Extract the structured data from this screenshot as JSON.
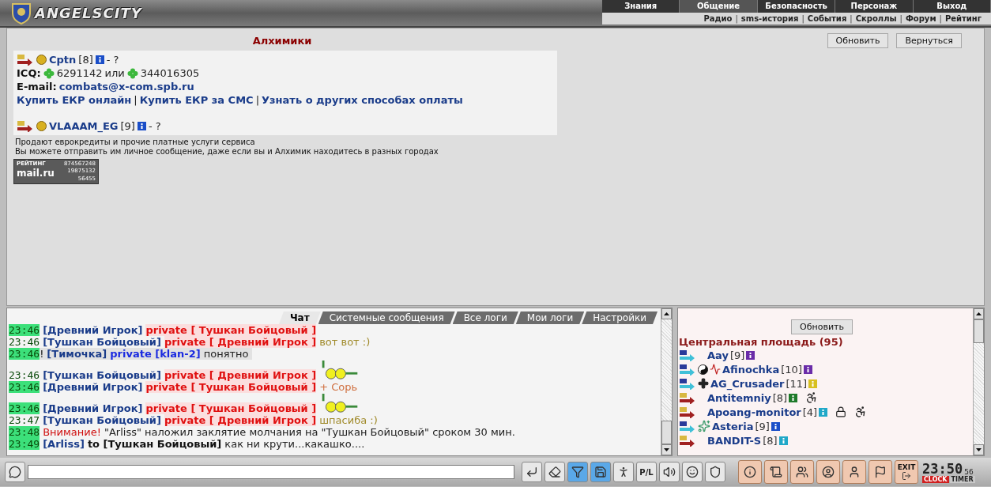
{
  "header": {
    "logo": "ANGELSCITY",
    "menu": [
      {
        "label": "Знания",
        "selected": false
      },
      {
        "label": "Общение",
        "selected": true
      },
      {
        "label": "Безопасность",
        "selected": false
      },
      {
        "label": "Персонаж",
        "selected": false
      },
      {
        "label": "Выход",
        "selected": false
      }
    ],
    "separator": "|",
    "submenu": [
      "Радио",
      "sms-история",
      "События",
      "Скроллы",
      "Форум",
      "Рейтинг"
    ]
  },
  "content": {
    "title": "Алхимики",
    "buttons": [
      "Обновить",
      "Вернуться"
    ],
    "alchemists": [
      {
        "name": "Cptn",
        "level": "[8]",
        "status": "- ?",
        "icq_label": "ICQ:",
        "icq": [
          "6291142",
          "344016305"
        ],
        "icq_joiner": "или",
        "email_label": "E-mail:",
        "email": "combats@x-com.spb.ru",
        "separator": "|",
        "links": [
          "Купить ЕКР онлайн",
          "Купить ЕКР за СМС",
          "Узнать о других способах оплаты"
        ]
      },
      {
        "name": "VLAAAM_EG",
        "level": "[9]",
        "status": "- ?"
      }
    ],
    "notes": [
      "Продают еврокредиты и прочие платные услуги сервиса",
      "Вы можете отправить им личное сообщение, даже если вы и Алхимик находитесь в разных городах"
    ],
    "counter": {
      "title": "РЕЙТИНГ",
      "total": "874567248",
      "brand": "mail.ru",
      "hits": "19875132",
      "hosts": "56455"
    }
  },
  "chat": {
    "tabs": [
      {
        "label": "Чат",
        "selected": true
      },
      {
        "label": "Системные сообщения",
        "selected": false
      },
      {
        "label": "Все логи",
        "selected": false
      },
      {
        "label": "Мои логи",
        "selected": false
      },
      {
        "label": "Настройки",
        "selected": false
      }
    ],
    "messages": [
      {
        "time": "23:46",
        "highlighted": true,
        "shaded": false,
        "smiley": false,
        "sender": "[Древний Игрок]",
        "kind": "private",
        "target": "private [ Тушкан Бойцовый ]"
      },
      {
        "time": "23:46",
        "highlighted": false,
        "shaded": false,
        "smiley": false,
        "sender": "[Тушкан Бойцовый]",
        "kind": "private",
        "target": "private [ Древний Игрок ]",
        "text": "вот вот :)",
        "color": "#a08a2a"
      },
      {
        "time": "23:46",
        "highlighted": true,
        "shaded": true,
        "smiley": false,
        "flag": "!",
        "sender": "[Тимочка]",
        "kind": "clan",
        "target": "private [klan-2]",
        "text": "понятно",
        "color": "#222222"
      },
      {
        "time": "23:46",
        "highlighted": false,
        "shaded": false,
        "smiley": true,
        "sender": "[Тушкан Бойцовый]",
        "kind": "private",
        "target": "private [ Древний Игрок ]"
      },
      {
        "time": "23:46",
        "highlighted": true,
        "shaded": false,
        "smiley": false,
        "sender": "[Древний Игрок]",
        "kind": "private",
        "target": "private [ Тушкан Бойцовый ]",
        "text": "+ Сорь",
        "color": "#d07040"
      },
      {
        "time": "23:46",
        "highlighted": true,
        "shaded": false,
        "smiley": true,
        "sender": "[Древний Игрок]",
        "kind": "private",
        "target": "private [ Тушкан Бойцовый ]"
      },
      {
        "time": "23:47",
        "highlighted": false,
        "shaded": false,
        "smiley": false,
        "sender": "[Тушкан Бойцовый]",
        "kind": "private",
        "target": "private [ Древний Игрок ]",
        "text": "шпасиба :)",
        "color": "#a08a2a"
      },
      {
        "time": "23:48",
        "highlighted": true,
        "shaded": false,
        "smiley": false,
        "kind": "system",
        "label": "Внимание!",
        "text": "\"Arliss\" наложил заклятие молчания на \"Тушкан Бойцовый\" сроком 30 мин.",
        "color": "#222222"
      },
      {
        "time": "23:49",
        "highlighted": true,
        "shaded": false,
        "smiley": false,
        "sender": "[Arliss]",
        "kind": "to",
        "target": "to [Тушкан Бойцовый]",
        "text": "как ни крути...какашко....",
        "color": "#222222"
      }
    ]
  },
  "online": {
    "refresh": "Обновить",
    "room": "Центральная площадь (95)",
    "users": [
      {
        "name": "Aay",
        "level": "[9]",
        "kind": "in",
        "color": "#6a2ca8"
      },
      {
        "name": "Afinochka",
        "level": "[10]",
        "kind": "in",
        "color": "#6a2ca8",
        "badges": [
          {
            "kind": "yinyang"
          },
          {
            "kind": "pulse"
          }
        ]
      },
      {
        "name": "AG_Crusader",
        "level": "[11]",
        "kind": "in",
        "color": "#d8c020",
        "badges": [
          {
            "kind": "cross"
          }
        ]
      },
      {
        "name": "Antitemniy",
        "level": "[8]",
        "kind": "out",
        "color": "#1e7a2a",
        "extras": [
          {
            "kind": "wheelchair"
          }
        ]
      },
      {
        "name": "Apoang-monitor",
        "level": "[4]",
        "kind": "out",
        "color": "#20a8c8",
        "extras": [
          {
            "kind": "lock"
          },
          {
            "kind": "wheelchair"
          }
        ]
      },
      {
        "name": "Asteria",
        "level": "[9]",
        "kind": "in",
        "color": "#1a4ec8",
        "badges": [
          {
            "kind": "emblem"
          }
        ]
      },
      {
        "name": "BANDIT-S",
        "level": "[8]",
        "kind": "out",
        "color": "#20a8c8"
      }
    ]
  },
  "toolbar": {
    "buttons": [
      {
        "kind": "enter",
        "selected": false
      },
      {
        "kind": "eraser",
        "selected": false
      },
      {
        "kind": "filter",
        "selected": true
      },
      {
        "kind": "save",
        "selected": true
      },
      {
        "kind": "runner",
        "selected": false
      },
      {
        "kind": "text",
        "label": "P/L",
        "selected": false
      },
      {
        "kind": "sound",
        "selected": false
      },
      {
        "kind": "smiley",
        "selected": false
      },
      {
        "kind": "shield",
        "selected": false
      }
    ],
    "actions": [
      {
        "kind": "info"
      },
      {
        "kind": "scroll"
      },
      {
        "kind": "users"
      },
      {
        "kind": "user-circle"
      },
      {
        "kind": "user"
      },
      {
        "kind": "flag"
      },
      {
        "kind": "exit",
        "label": "EXIT"
      }
    ],
    "clock": {
      "time": "23:50",
      "seconds": "56",
      "modes": [
        {
          "label": "CLOCK",
          "selected": true
        },
        {
          "label": "TIMER",
          "selected": false
        }
      ]
    }
  }
}
